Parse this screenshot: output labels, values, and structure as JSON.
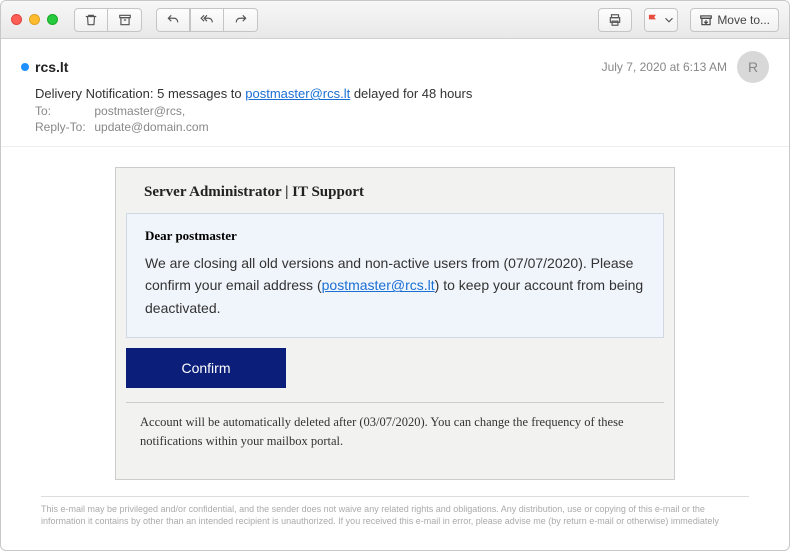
{
  "toolbar": {
    "move_label": "Move to..."
  },
  "header": {
    "sender": "rcs.lt",
    "timestamp": "July 7, 2020 at 6:13 AM",
    "avatar_initial": "R",
    "subject_prefix": "Delivery Notification: 5 messages to ",
    "subject_email": "postmaster@rcs.lt",
    "subject_suffix": " delayed for 48 hours",
    "to_label": "To:",
    "to_value": "postmaster@rcs,",
    "replyto_label": "Reply-To:",
    "replyto_value": "update@domain.com"
  },
  "email": {
    "card_title": "Server Administrator | IT Support",
    "dear": "Dear postmaster",
    "msg_p1": "We are closing all old versions and non-active users from (07/07/2020). Please confirm your email address (",
    "msg_email": "postmaster@rcs.lt",
    "msg_p2": ") to keep your account from being deactivated.",
    "confirm_label": "Confirm",
    "notice": "Account will be  automatically deleted after (03/07/2020). You can change the frequency of these notifications within your mailbox portal."
  },
  "disclaimer": "This e-mail may be privileged and/or confidential, and the sender does not waive any related rights and obligations. Any distribution, use or copying of this e-mail or the information it contains by other than an intended recipient is unauthorized. If you received this e-mail in error, please advise me (by return e-mail or otherwise) immediately"
}
